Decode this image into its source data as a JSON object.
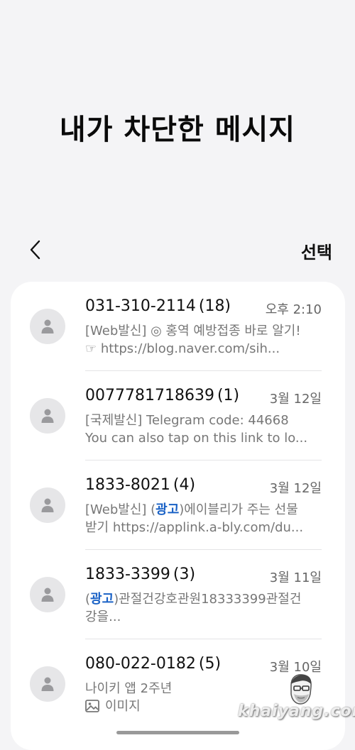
{
  "header": {
    "title": "내가 차단한 메시지",
    "select_label": "선택"
  },
  "messages": [
    {
      "name": "031-310-2114",
      "count": "(18)",
      "time": "오후 2:10",
      "preview_line1": "[Web발신] ◎ 홍역 예방접종 바로 알기!",
      "preview_line2": " ☞ https://blog.naver.com/sih..."
    },
    {
      "name": "0077781718639",
      "count": "(1)",
      "time": "3월 12일",
      "preview_line1": "[국제발신] Telegram code: 44668",
      "preview_line2": "You can also tap on this link to lo..."
    },
    {
      "name": "1833-8021",
      "count": "(4)",
      "time": "3월 12일",
      "preview_pre": "[Web발신] (",
      "preview_ad": "광고",
      "preview_post": ")에이블리가 주는 선물",
      "preview_line2": "받기 https://applink.a-bly.com/du..."
    },
    {
      "name": "1833-3399",
      "count": "(3)",
      "time": "3월 11일",
      "preview_pre": "(",
      "preview_ad": "광고",
      "preview_post": ")관절건강호관원18333399관절건",
      "preview_line2": "강을..."
    },
    {
      "name": "080-022-0182",
      "count": "(5)",
      "time": "3월 10일",
      "preview_line1": "나이키 앱 2주년",
      "attachment_label": "이미지"
    }
  ],
  "watermark": "khaiyang.com",
  "icons": {
    "back": "chevron-left-icon",
    "avatar": "person-icon",
    "attachment": "image-icon"
  }
}
